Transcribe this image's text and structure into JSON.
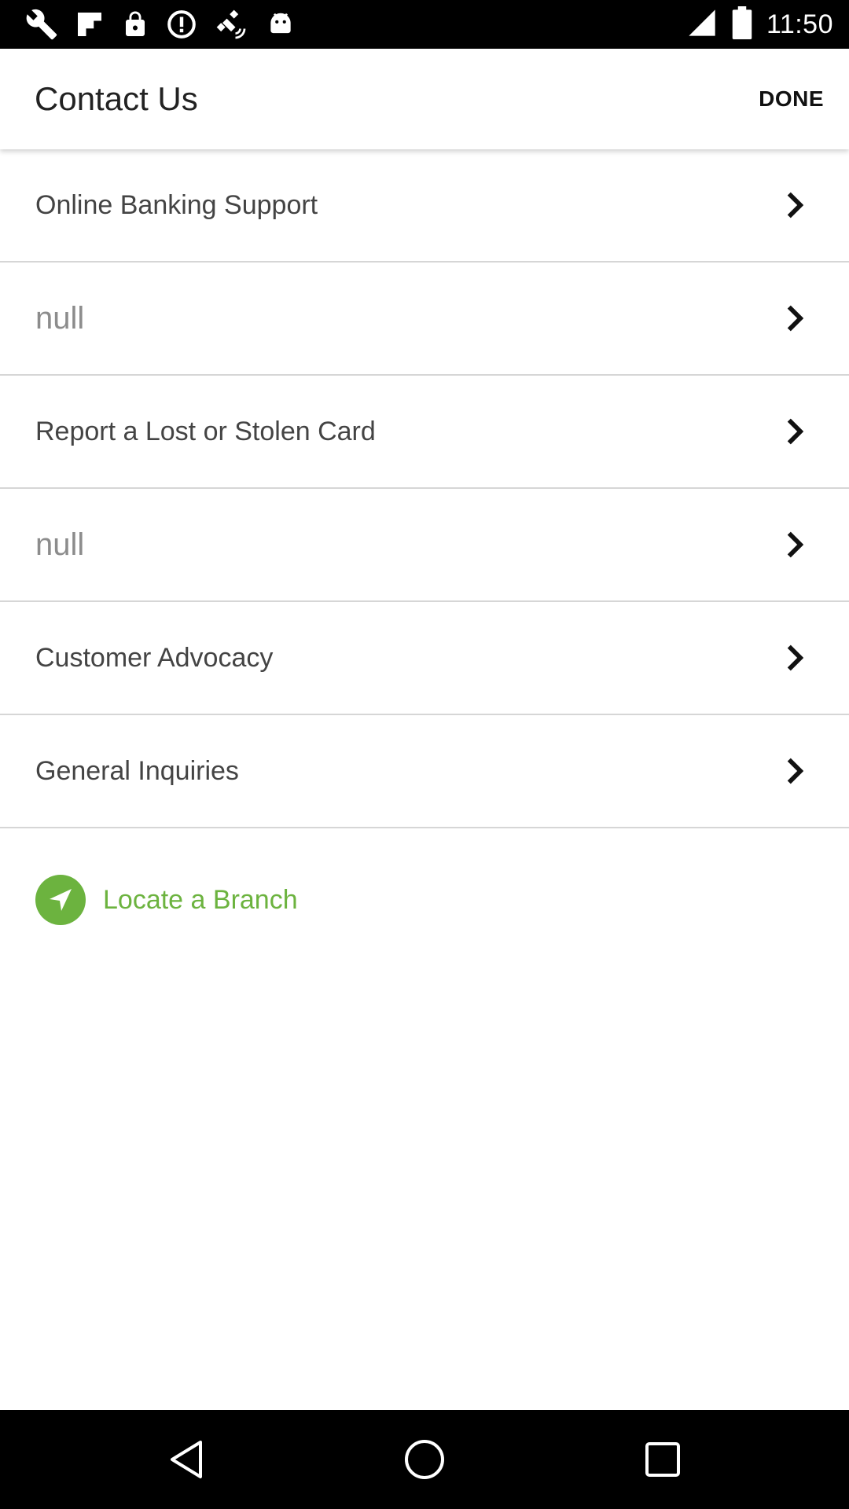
{
  "status_bar": {
    "time": "11:50",
    "left_icons": [
      "wrench-icon",
      "flipboard-icon",
      "lock-icon",
      "alert-icon",
      "fake-gps-icon",
      "android-debug-icon"
    ],
    "right_icons": [
      "signal-icon",
      "battery-icon"
    ]
  },
  "header": {
    "title": "Contact Us",
    "done_label": "DONE"
  },
  "menu": {
    "items": [
      {
        "label": "Online Banking Support",
        "muted": false
      },
      {
        "label": "null",
        "muted": true
      },
      {
        "label": "Report a Lost or Stolen Card",
        "muted": false
      },
      {
        "label": "null",
        "muted": true
      },
      {
        "label": "Customer Advocacy",
        "muted": false
      },
      {
        "label": "General Inquiries",
        "muted": false
      }
    ]
  },
  "locate": {
    "label": "Locate a Branch",
    "icon": "navigation-arrow-icon"
  },
  "navigation": {
    "buttons": [
      "back-icon",
      "home-icon",
      "recents-icon"
    ]
  },
  "colors": {
    "accent_green": "#6cb33f",
    "status_bar": "#000000",
    "text_primary": "#444444",
    "text_muted": "#8c8c8c",
    "divider": "#d6d6d6"
  }
}
